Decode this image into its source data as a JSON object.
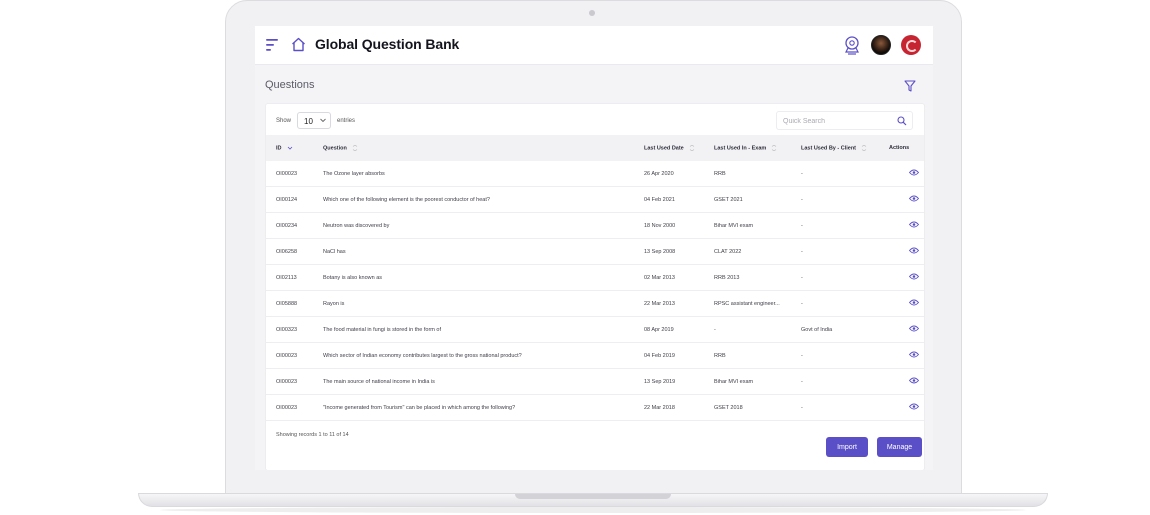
{
  "app": {
    "title": "Global Question Bank"
  },
  "page": {
    "section_title": "Questions"
  },
  "toolbar": {
    "show_label": "Show",
    "entries_value": "10",
    "entries_label": "entries",
    "search_placeholder": "Quick Search"
  },
  "table": {
    "columns": [
      "ID",
      "Question",
      "Last Used Date",
      "Last Used In - Exam",
      "Last Used By - Client",
      "Actions"
    ],
    "rows": [
      {
        "id": "OI00023",
        "question": "The Ozone layer absorbs",
        "date": "26 Apr 2020",
        "exam": "RRB",
        "client": "-"
      },
      {
        "id": "OI00124",
        "question": "Which one of the following element is the poorest conductor of heat?",
        "date": "04 Feb 2021",
        "exam": "GSET 2021",
        "client": "-"
      },
      {
        "id": "OI00234",
        "question": "Neutron was discovered by",
        "date": "18 Nov 2000",
        "exam": "Bihar MVI exam",
        "client": "-"
      },
      {
        "id": "OI06258",
        "question": "NaCl has",
        "date": "13 Sep 2008",
        "exam": "CLAT 2022",
        "client": "-"
      },
      {
        "id": "OI02113",
        "question": "Botany is also known as",
        "date": "02 Mar 2013",
        "exam": "RRB 2013",
        "client": "-"
      },
      {
        "id": "OI05888",
        "question": "Rayon is",
        "date": "22 Mar 2013",
        "exam": "RPSC assistant engineer...",
        "client": "-"
      },
      {
        "id": "OI00323",
        "question": "The food material in fungi is stored in the form of",
        "date": "08 Apr 2019",
        "exam": "-",
        "client": "Govt of India"
      },
      {
        "id": "OI00023",
        "question": "Which sector of Indian economy contributes largest to the gross national product?",
        "date": "04 Feb 2019",
        "exam": "RRB",
        "client": "-"
      },
      {
        "id": "OI00023",
        "question": "The main source of national income in India is",
        "date": "13 Sep 2019",
        "exam": "Bihar MVI exam",
        "client": "-"
      },
      {
        "id": "OI00023",
        "question": "\"Income generated from Tourism\" can be placed in which among the following?",
        "date": "22 Mar 2018",
        "exam": "GSET 2018",
        "client": "-"
      }
    ]
  },
  "footer": {
    "records_text": "Showing records 1 to 11 of 14"
  },
  "buttons": {
    "import": "Import",
    "manage": "Manage"
  },
  "colors": {
    "accent": "#5b4fc8",
    "title": "#14141e",
    "brand_red": "#c52430"
  },
  "icons": [
    "menu-icon",
    "home-icon",
    "bulb-icon",
    "avatar",
    "brand-icon",
    "filter-icon",
    "search-icon",
    "chevron-down-icon",
    "sort-icon",
    "eye-icon"
  ]
}
